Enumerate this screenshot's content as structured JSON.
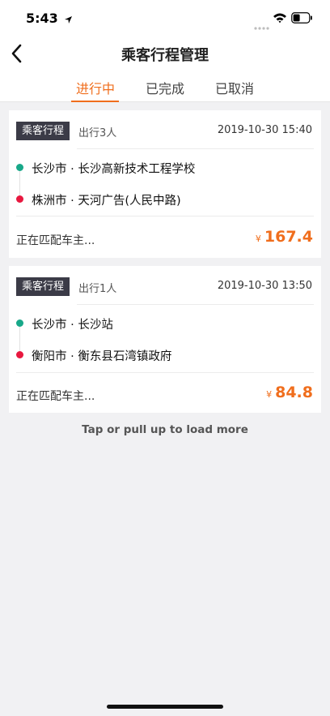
{
  "status_bar": {
    "time": "5:43",
    "icons": [
      "location-arrow-icon",
      "cellular-dots-icon",
      "wifi-icon",
      "battery-icon"
    ]
  },
  "nav": {
    "title": "乘客行程管理",
    "back_icon": "chevron-left-icon"
  },
  "tabs": [
    {
      "label": "进行中",
      "active": true
    },
    {
      "label": "已完成",
      "active": false
    },
    {
      "label": "已取消",
      "active": false
    }
  ],
  "trips": [
    {
      "badge": "乘客行程",
      "passengers": "出行3人",
      "datetime": "2019-10-30 15:40",
      "from": "长沙市 · 长沙高新技术工程学校",
      "to": "株洲市 · 天河广告(人民中路)",
      "status": "正在匹配车主...",
      "currency": "¥",
      "price": "167.4"
    },
    {
      "badge": "乘客行程",
      "passengers": "出行1人",
      "datetime": "2019-10-30 13:50",
      "from": "长沙市 · 长沙站",
      "to": "衡阳市 · 衡东县石湾镇政府",
      "status": "正在匹配车主...",
      "currency": "¥",
      "price": "84.8"
    }
  ],
  "load_more": "Tap or pull up to load more",
  "colors": {
    "accent": "#f06e1d",
    "badge_bg": "#3b3b47",
    "origin_dot": "#18a889",
    "destination_dot": "#e8183f",
    "background": "#f1f1f3"
  }
}
